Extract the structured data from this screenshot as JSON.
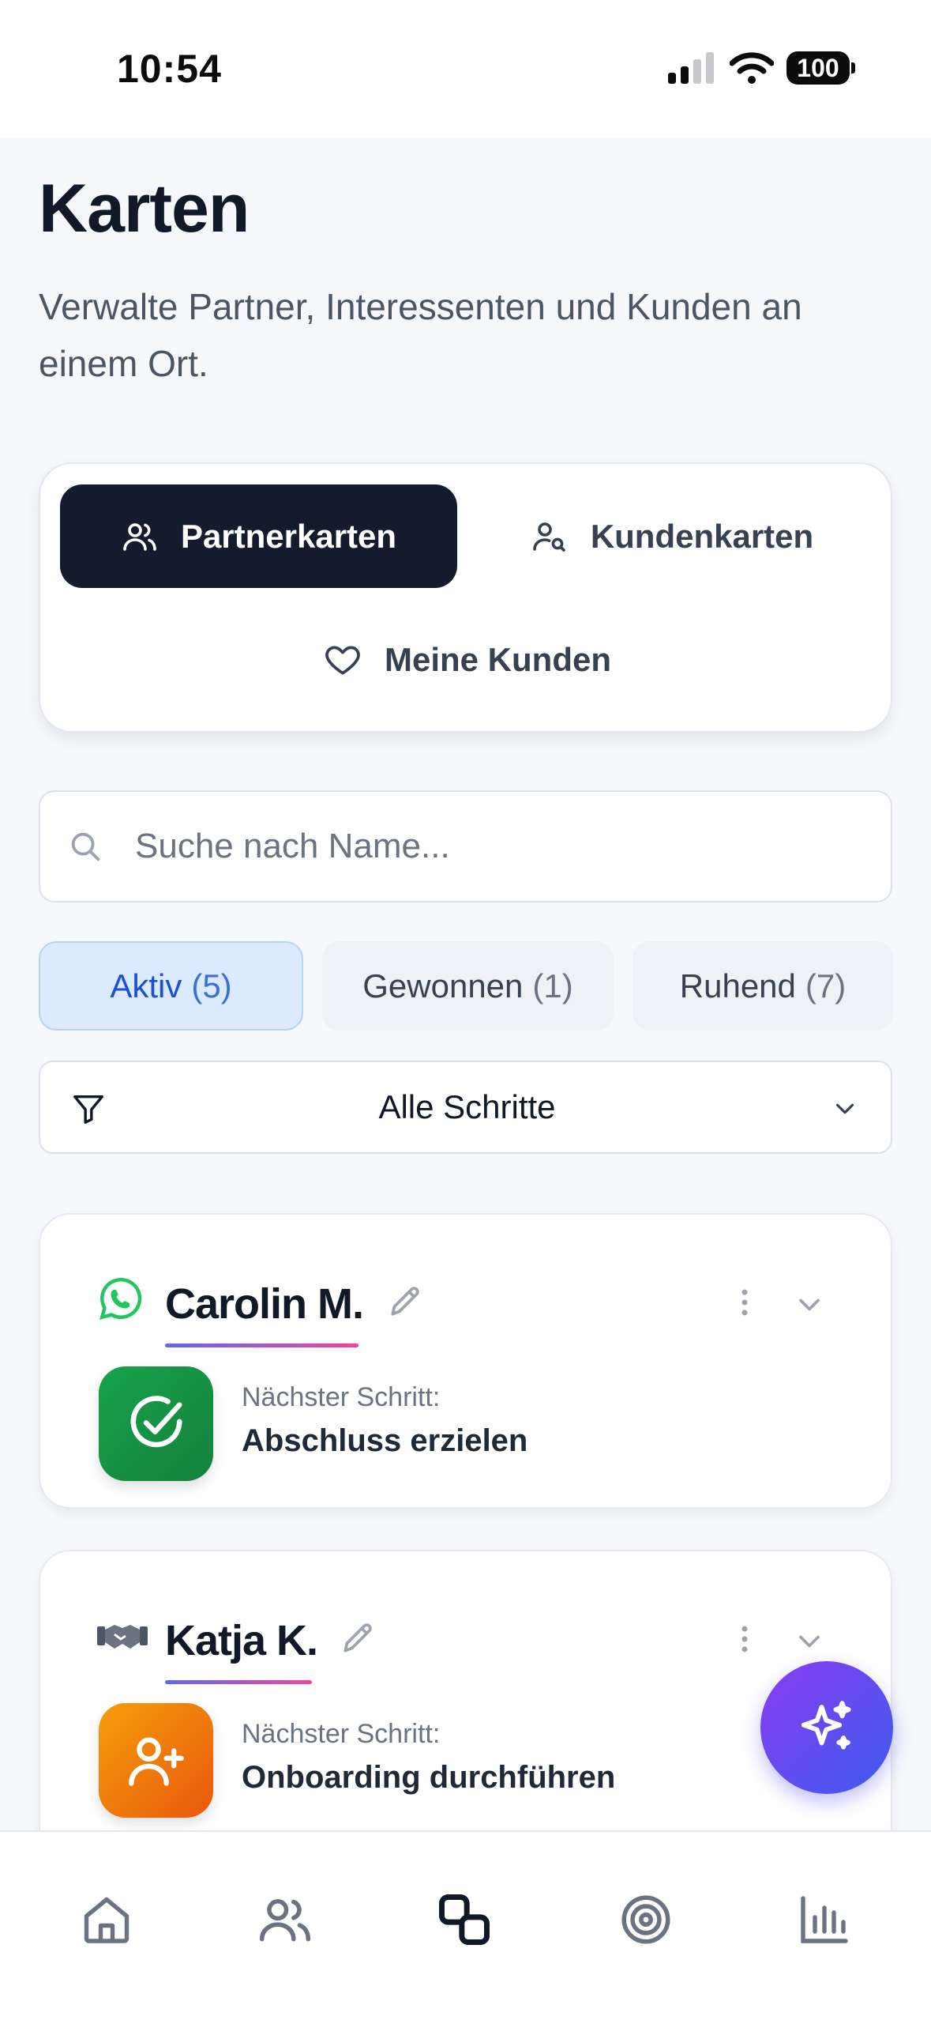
{
  "status_bar": {
    "time": "10:54",
    "battery": "100"
  },
  "page": {
    "title": "Karten",
    "subtitle": "Verwalte Partner, Interessenten und Kunden an einem Ort."
  },
  "segments": {
    "partner": "Partnerkarten",
    "kunden": "Kundenkarten",
    "meine": "Meine Kunden"
  },
  "search": {
    "placeholder": "Suche nach Name..."
  },
  "chips": [
    {
      "label": "Aktiv",
      "count": "(5)"
    },
    {
      "label": "Gewonnen",
      "count": "(1)"
    },
    {
      "label": "Ruhend",
      "count": "(7)"
    }
  ],
  "filter": {
    "label": "Alle Schritte"
  },
  "cards": [
    {
      "name": "Carolin M.",
      "step_label": "Nächster Schritt:",
      "step_value": "Abschluss erzielen",
      "source_icon": "whatsapp-icon",
      "step_icon": "check-circle-icon",
      "badge_color": "#16a34a"
    },
    {
      "name": "Katja K.",
      "step_label": "Nächster Schritt:",
      "step_value": "Onboarding durchführen",
      "source_icon": "handshake-icon",
      "step_icon": "user-plus-icon",
      "badge_color": "#f97316"
    }
  ],
  "fab": {
    "icon": "sparkles-icon"
  },
  "tabbar": [
    "home-icon",
    "users-icon",
    "cards-icon",
    "target-icon",
    "chart-icon"
  ]
}
